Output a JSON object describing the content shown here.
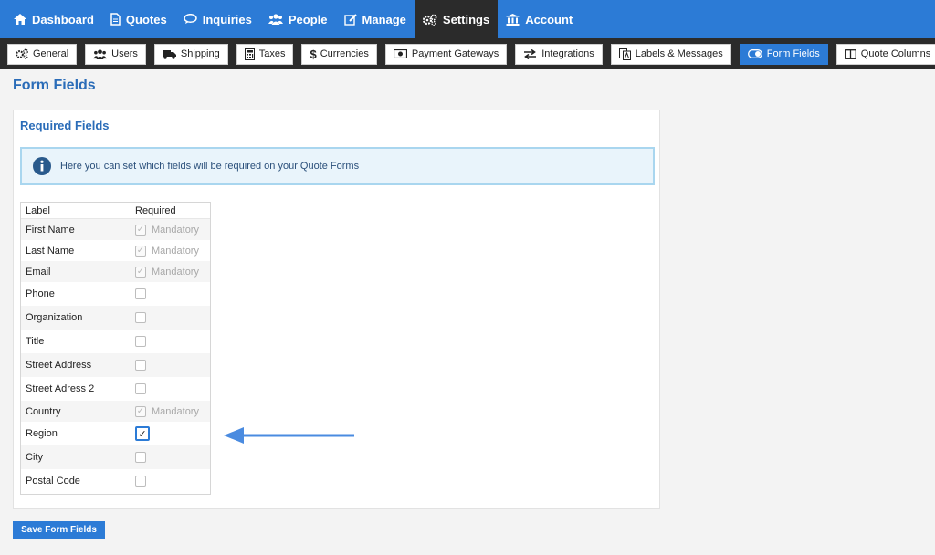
{
  "topnav": {
    "items": [
      {
        "label": "Dashboard",
        "icon": "home-icon"
      },
      {
        "label": "Quotes",
        "icon": "document-icon"
      },
      {
        "label": "Inquiries",
        "icon": "speech-bubble-icon"
      },
      {
        "label": "People",
        "icon": "users-icon"
      },
      {
        "label": "Manage",
        "icon": "edit-icon"
      },
      {
        "label": "Settings",
        "icon": "gears-icon",
        "active": true
      },
      {
        "label": "Account",
        "icon": "bank-icon"
      }
    ]
  },
  "subnav": {
    "tabs": [
      {
        "label": "General",
        "icon": "gears-icon"
      },
      {
        "label": "Users",
        "icon": "users-icon"
      },
      {
        "label": "Shipping",
        "icon": "truck-icon"
      },
      {
        "label": "Taxes",
        "icon": "calculator-icon"
      },
      {
        "label": "Currencies",
        "icon": "dollar-icon"
      },
      {
        "label": "Payment Gateways",
        "icon": "money-icon"
      },
      {
        "label": "Integrations",
        "icon": "exchange-icon"
      },
      {
        "label": "Labels & Messages",
        "icon": "translate-icon"
      },
      {
        "label": "Form Fields",
        "icon": "toggle-icon",
        "active": true
      },
      {
        "label": "Quote Columns",
        "icon": "columns-icon"
      }
    ]
  },
  "page": {
    "title": "Form Fields"
  },
  "panel": {
    "title": "Required Fields",
    "info": "Here you can set which fields will be required on your Quote Forms"
  },
  "table": {
    "headers": {
      "label": "Label",
      "required": "Required"
    },
    "rows": [
      {
        "label": "First Name",
        "state": "mandatory",
        "note": "Mandatory"
      },
      {
        "label": "Last Name",
        "state": "mandatory",
        "note": "Mandatory"
      },
      {
        "label": "Email",
        "state": "mandatory",
        "note": "Mandatory"
      },
      {
        "label": "Phone",
        "state": "unchecked"
      },
      {
        "label": "Organization",
        "state": "unchecked"
      },
      {
        "label": "Title",
        "state": "unchecked"
      },
      {
        "label": "Street Address",
        "state": "unchecked"
      },
      {
        "label": "Street Adress 2",
        "state": "unchecked"
      },
      {
        "label": "Country",
        "state": "mandatory",
        "note": "Mandatory"
      },
      {
        "label": "Region",
        "state": "checked"
      },
      {
        "label": "City",
        "state": "unchecked"
      },
      {
        "label": "Postal Code",
        "state": "unchecked"
      }
    ]
  },
  "buttons": {
    "save": "Save Form Fields"
  },
  "colors": {
    "primary": "#2c7bd6",
    "dark": "#2b2b2b",
    "title": "#2a6cb8",
    "arrow": "#4a8be0"
  }
}
